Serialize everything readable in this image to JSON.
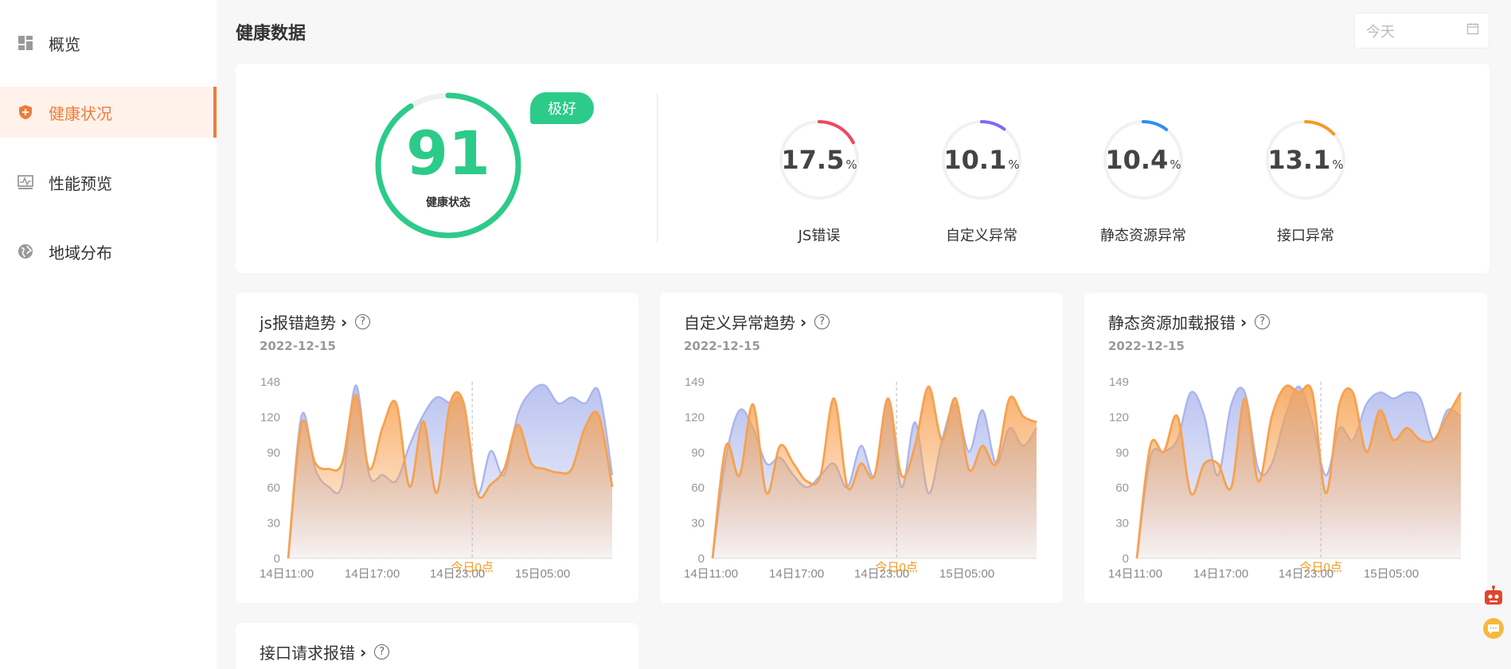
{
  "sidebar": {
    "items": [
      {
        "label": "概览",
        "icon": "dashboard-icon"
      },
      {
        "label": "健康状况",
        "icon": "shield-plus-icon",
        "active": true
      },
      {
        "label": "性能预览",
        "icon": "pulse-icon"
      },
      {
        "label": "地域分布",
        "icon": "globe-icon"
      }
    ]
  },
  "header": {
    "title": "健康数据",
    "date_placeholder": "今天",
    "date_icon": "calendar-icon"
  },
  "health": {
    "score": "91",
    "score_value": 91,
    "score_label": "健康状态",
    "badge": "极好",
    "ring_color": "#2ccb8a",
    "metrics": [
      {
        "value": "17.5",
        "unit": "%",
        "label": "JS错误",
        "color": "#f0475e",
        "fraction": 0.175
      },
      {
        "value": "10.1",
        "unit": "%",
        "label": "自定义异常",
        "color": "#7b6cf5",
        "fraction": 0.101
      },
      {
        "value": "10.4",
        "unit": "%",
        "label": "静态资源异常",
        "color": "#2f8df5",
        "fraction": 0.104
      },
      {
        "value": "13.1",
        "unit": "%",
        "label": "接口异常",
        "color": "#f59a23",
        "fraction": 0.131
      }
    ]
  },
  "charts": [
    {
      "title": "js报错趋势",
      "date": "2022-12-15"
    },
    {
      "title": "自定义异常趋势",
      "date": "2022-12-15"
    },
    {
      "title": "静态资源加载报错",
      "date": "2022-12-15"
    }
  ],
  "bottom_chart": {
    "title": "接口请求报错"
  },
  "chart_data": [
    {
      "type": "area",
      "ylim": [
        0,
        148
      ],
      "yticks": [
        "148",
        "120",
        "90",
        "60",
        "30",
        "0"
      ],
      "xticks": [
        "14日11:00",
        "14日17:00",
        "14日23:00",
        "15日05:00"
      ],
      "marker_label": "今日0点",
      "series": [
        {
          "color": "#aab5ec",
          "values": [
            0,
            120,
            75,
            60,
            62,
            145,
            70,
            70,
            65,
            95,
            120,
            135,
            130,
            130,
            55,
            90,
            70,
            120,
            140,
            145,
            130,
            135,
            130,
            140,
            70
          ]
        },
        {
          "color": "#f7a150",
          "values": [
            0,
            113,
            80,
            75,
            80,
            137,
            75,
            110,
            130,
            60,
            115,
            55,
            130,
            130,
            55,
            62,
            75,
            112,
            80,
            75,
            72,
            75,
            110,
            120,
            60
          ]
        }
      ]
    },
    {
      "type": "area",
      "ylim": [
        0,
        149
      ],
      "yticks": [
        "149",
        "120",
        "90",
        "60",
        "30",
        "0"
      ],
      "xticks": [
        "14日11:00",
        "14日17:00",
        "14日23:00",
        "15日05:00"
      ],
      "marker_label": "今日0点",
      "series": [
        {
          "color": "#aab5ec",
          "values": [
            0,
            85,
            125,
            110,
            80,
            85,
            70,
            60,
            70,
            80,
            60,
            95,
            70,
            135,
            60,
            115,
            55,
            100,
            130,
            90,
            125,
            80,
            110,
            95,
            110
          ]
        },
        {
          "color": "#f7a150",
          "values": [
            0,
            95,
            70,
            130,
            55,
            95,
            80,
            65,
            70,
            135,
            60,
            80,
            70,
            135,
            70,
            95,
            145,
            100,
            135,
            75,
            95,
            80,
            135,
            120,
            115
          ]
        }
      ]
    },
    {
      "type": "area",
      "ylim": [
        0,
        149
      ],
      "yticks": [
        "149",
        "120",
        "90",
        "60",
        "30",
        "0"
      ],
      "xticks": [
        "14日11:00",
        "14日17:00",
        "14日23:00",
        "15日05:00"
      ],
      "marker_label": "今日0点",
      "series": [
        {
          "color": "#aab5ec",
          "values": [
            0,
            85,
            90,
            100,
            140,
            120,
            70,
            130,
            140,
            75,
            80,
            120,
            145,
            115,
            70,
            110,
            100,
            130,
            140,
            135,
            140,
            135,
            100,
            125,
            120
          ]
        },
        {
          "color": "#f7a150",
          "values": [
            0,
            95,
            90,
            120,
            55,
            80,
            80,
            60,
            135,
            65,
            120,
            145,
            140,
            140,
            55,
            130,
            140,
            90,
            125,
            100,
            110,
            100,
            100,
            120,
            140
          ]
        }
      ]
    }
  ]
}
